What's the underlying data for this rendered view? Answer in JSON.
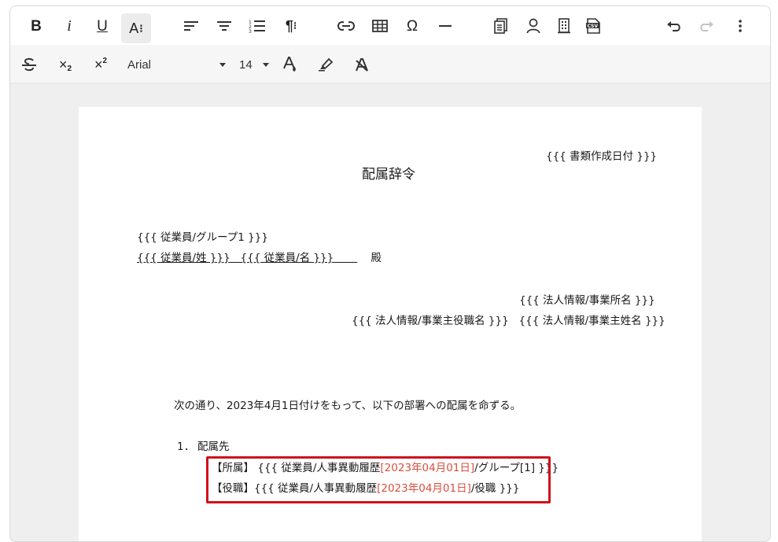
{
  "toolbar": {
    "bold_label": "B",
    "italic_label": "i",
    "underline_label": "U",
    "fontsize_icon_label": "A",
    "subscript_label": "×",
    "subscript_index": "2",
    "superscript_label": "×",
    "superscript_index": "2",
    "omega_label": "Ω",
    "font_family_value": "Arial",
    "font_size_value": "14",
    "icons": [
      "bold",
      "italic",
      "underline",
      "font-size",
      "align-left",
      "align-center",
      "numbered-list",
      "paragraph",
      "link",
      "table",
      "special-character",
      "horizontal-rule",
      "template",
      "user",
      "building",
      "csv",
      "undo",
      "redo",
      "more",
      "strikethrough",
      "subscript",
      "superscript",
      "text-color",
      "highlighter",
      "clear-format"
    ]
  },
  "document": {
    "date_placeholder": "{{{ 書類作成日付 }}}",
    "title": "配属辞令",
    "recipient_group": "{{{ 従業員/グループ1 }}}",
    "recipient_surname": "{{{ 従業員/姓 }}}",
    "recipient_name": "{{{ 従業員/名 }}}",
    "honorific": "殿",
    "company_office": "{{{ 法人情報/事業所名 }}}",
    "company_owner_title": "{{{ 法人情報/事業主役職名 }}}",
    "company_owner_name": "{{{ 法人情報/事業主姓名 }}}",
    "body_text": "次の通り、2023年4月1日付けをもって、以下の部署への配属を命ずる。",
    "list_number": "1.",
    "list_title": "配属先",
    "assignment_dept_label": "【所属】",
    "assignment_dept_prefix": "{{{ 従業員/人事異動履歴",
    "assignment_dept_date": "[2023年04月01日]",
    "assignment_dept_suffix": "/グループ[1] }}}",
    "assignment_role_label": "【役職】",
    "assignment_role_prefix": "{{{ 従業員/人事異動履歴",
    "assignment_role_date": "[2023年04月01日]",
    "assignment_role_suffix": "/役職 }}}"
  },
  "colors": {
    "highlight_border": "#d0101c",
    "date_text": "#d9503f"
  }
}
